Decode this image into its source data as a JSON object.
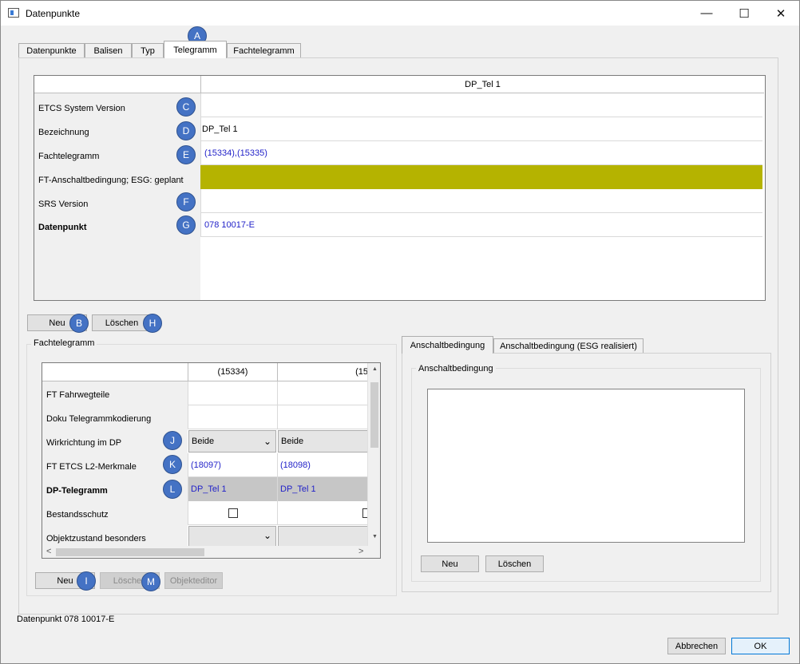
{
  "window": {
    "title": "Datenpunkte",
    "minimize": "—",
    "maximize": "☐",
    "close": "✕"
  },
  "tabs": [
    "Datenpunkte",
    "Balisen",
    "Typ",
    "Telegramm",
    "Fachtelegramm"
  ],
  "active_tab": "Telegramm",
  "telegram_table": {
    "column_header": "DP_Tel 1",
    "rows": [
      {
        "label": "ETCS System Version",
        "value": ""
      },
      {
        "label": "Bezeichnung",
        "value": "DP_Tel 1"
      },
      {
        "label": "Fachtelegramm",
        "value": "(15334),(15335)"
      },
      {
        "label": "FT-Anschaltbedingung; ESG: geplant",
        "value": "",
        "fill": "#b5b300"
      },
      {
        "label": "SRS Version",
        "value": ""
      },
      {
        "label": "Datenpunkt",
        "value": "078 10017-E"
      }
    ]
  },
  "telegram_buttons": {
    "neu": "Neu",
    "loeschen": "Löschen"
  },
  "fachtelegramm_group": {
    "title": "Fachtelegramm",
    "columns": [
      "(15334)",
      "(15"
    ],
    "rows": [
      {
        "label": "FT Fahrwegteile",
        "c1": "",
        "c2": ""
      },
      {
        "label": "Doku Telegrammkodierung",
        "c1": "",
        "c2": ""
      },
      {
        "label": "Wirkrichtung im DP",
        "c1": "Beide",
        "c2": "Beide"
      },
      {
        "label": "FT ETCS L2-Merkmale",
        "c1": "(18097)",
        "c2": "(18098)"
      },
      {
        "label": "DP-Telegramm",
        "c1": "DP_Tel 1",
        "c2": "DP_Tel 1"
      },
      {
        "label": "Bestandsschutz",
        "c1": "",
        "c2": ""
      },
      {
        "label": "Objektzustand besonders",
        "c1": "",
        "c2": ""
      }
    ],
    "buttons": {
      "neu": "Neu",
      "loeschen": "Löschen",
      "objekteditor": "Objekteditor"
    }
  },
  "anschalt_tabs": [
    "Anschaltbedingung",
    "Anschaltbedingung (ESG realisiert)"
  ],
  "anschalt_group": {
    "title": "Anschaltbedingung",
    "neu": "Neu",
    "loeschen": "Löschen"
  },
  "status": "Datenpunkt 078 10017-E",
  "footer": {
    "abbrechen": "Abbrechen",
    "ok": "OK"
  },
  "badges": {
    "A": "A",
    "B": "B",
    "C": "C",
    "D": "D",
    "E": "E",
    "F": "F",
    "G": "G",
    "H": "H",
    "I": "I",
    "J": "J",
    "K": "K",
    "L": "L",
    "M": "M"
  },
  "icons": {
    "chevron": "⌄",
    "scroll_up": "▲",
    "scroll_down": "▼",
    "scroll_left": "<",
    "scroll_right": ">"
  }
}
